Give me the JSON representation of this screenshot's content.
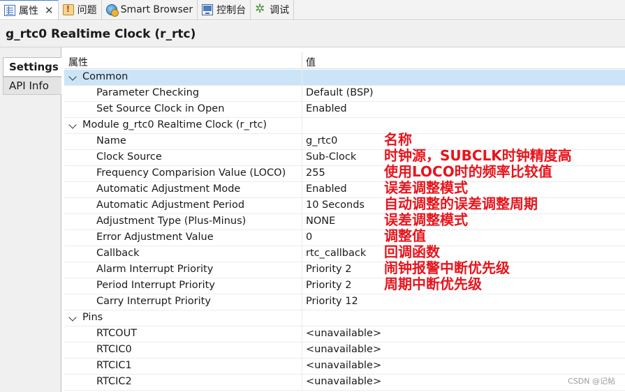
{
  "tabs": [
    {
      "label": "属性",
      "icon": "properties-icon",
      "active": true
    },
    {
      "label": "问题",
      "icon": "problems-icon"
    },
    {
      "label": "Smart Browser",
      "icon": "globe-icon"
    },
    {
      "label": "控制台",
      "icon": "console-icon"
    },
    {
      "label": "调试",
      "icon": "debug-icon"
    }
  ],
  "title": "g_rtc0 Realtime Clock (r_rtc)",
  "side_tabs": {
    "settings": "Settings",
    "api_info": "API Info"
  },
  "columns": {
    "property": "属性",
    "value": "值"
  },
  "rows": [
    {
      "name": "Common",
      "value": "",
      "group": true
    },
    {
      "name": "Parameter Checking",
      "value": "Default (BSP)"
    },
    {
      "name": "Set Source Clock in Open",
      "value": "Enabled"
    },
    {
      "name": "Module g_rtc0 Realtime Clock (r_rtc)",
      "value": "",
      "group": true
    },
    {
      "name": "Name",
      "value": "g_rtc0"
    },
    {
      "name": "Clock Source",
      "value": "Sub-Clock"
    },
    {
      "name": "Frequency Comparision Value (LOCO)",
      "value": "255"
    },
    {
      "name": "Automatic Adjustment Mode",
      "value": "Enabled"
    },
    {
      "name": "Automatic Adjustment Period",
      "value": "10 Seconds"
    },
    {
      "name": "Adjustment Type (Plus-Minus)",
      "value": "NONE"
    },
    {
      "name": "Error Adjustment Value",
      "value": "0"
    },
    {
      "name": "Callback",
      "value": "rtc_callback"
    },
    {
      "name": "Alarm Interrupt Priority",
      "value": "Priority 2"
    },
    {
      "name": "Period Interrupt Priority",
      "value": "Priority 2"
    },
    {
      "name": "Carry Interrupt Priority",
      "value": "Priority 12"
    },
    {
      "name": "Pins",
      "value": "",
      "group": true
    },
    {
      "name": "RTCOUT",
      "value": "<unavailable>"
    },
    {
      "name": "RTCIC0",
      "value": "<unavailable>"
    },
    {
      "name": "RTCIC1",
      "value": "<unavailable>"
    },
    {
      "name": "RTCIC2",
      "value": "<unavailable>"
    }
  ],
  "annotations": [
    {
      "row": 4,
      "text": "名称"
    },
    {
      "row": 5,
      "text": "时钟源，SUBCLK时钟精度高"
    },
    {
      "row": 6,
      "text": "使用LOCO时的频率比较值"
    },
    {
      "row": 7,
      "text": "误差调整模式"
    },
    {
      "row": 8,
      "text": "自动调整的误差调整周期"
    },
    {
      "row": 9,
      "text": "误差调整模式"
    },
    {
      "row": 10,
      "text": "调整值"
    },
    {
      "row": 11,
      "text": "回调函数"
    },
    {
      "row": 12,
      "text": "闹钟报警中断优先级"
    },
    {
      "row": 13,
      "text": "周期中断优先级"
    }
  ],
  "watermark": "CSDN @记帖",
  "colors": {
    "accent": "#3d7fd3",
    "selection": "#cce4f7",
    "annotation": "#e8141c"
  }
}
